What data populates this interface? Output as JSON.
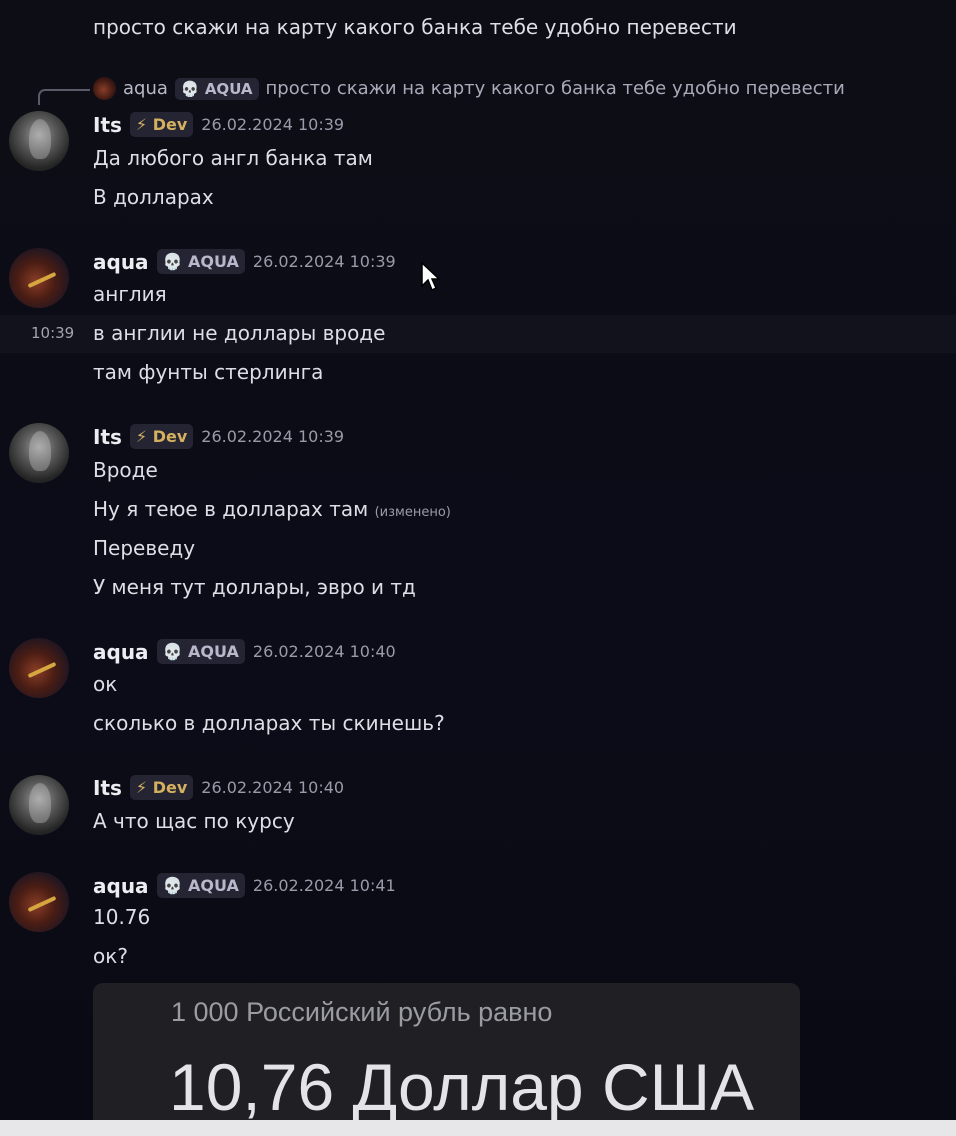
{
  "top_message": "просто скажи на карту какого банка тебе удобно перевести",
  "reply": {
    "author": "aqua",
    "tag": "AQUA",
    "text": "просто скажи на карту какого банка тебе удобно перевести"
  },
  "hover_time": "10:39",
  "tags": {
    "skull": "💀",
    "bolt": "⚡"
  },
  "messages": [
    {
      "author": "Its",
      "tag": "Dev",
      "timestamp": "26.02.2024 10:39",
      "lines": [
        "Да любого англ банка там",
        "В долларах"
      ]
    },
    {
      "author": "aqua",
      "tag": "AQUA",
      "timestamp": "26.02.2024 10:39",
      "lines": [
        "англия",
        "в англии не доллары вроде",
        "там фунты стерлинга"
      ]
    },
    {
      "author": "Its",
      "tag": "Dev",
      "timestamp": "26.02.2024 10:39",
      "lines": [
        "Вроде",
        "Ну я теюе в долларах там",
        "Переведу",
        "У меня тут доллары, эвро и тд"
      ],
      "edited_label": "(изменено)"
    },
    {
      "author": "aqua",
      "tag": "AQUA",
      "timestamp": "26.02.2024 10:40",
      "lines": [
        "ок",
        "сколько в долларах ты скинешь?"
      ]
    },
    {
      "author": "Its",
      "tag": "Dev",
      "timestamp": "26.02.2024 10:40",
      "lines": [
        "А что щас по курсу"
      ]
    },
    {
      "author": "aqua",
      "tag": "AQUA",
      "timestamp": "26.02.2024 10:41",
      "lines": [
        "10.76",
        "ок?"
      ]
    }
  ],
  "embed": {
    "small": "1 000 Российский рубль равно",
    "big": "10,76 Доллар США"
  },
  "colors": {
    "background": "#0d0d16",
    "tag_bg": "#242433",
    "dev": "#d4b060"
  }
}
